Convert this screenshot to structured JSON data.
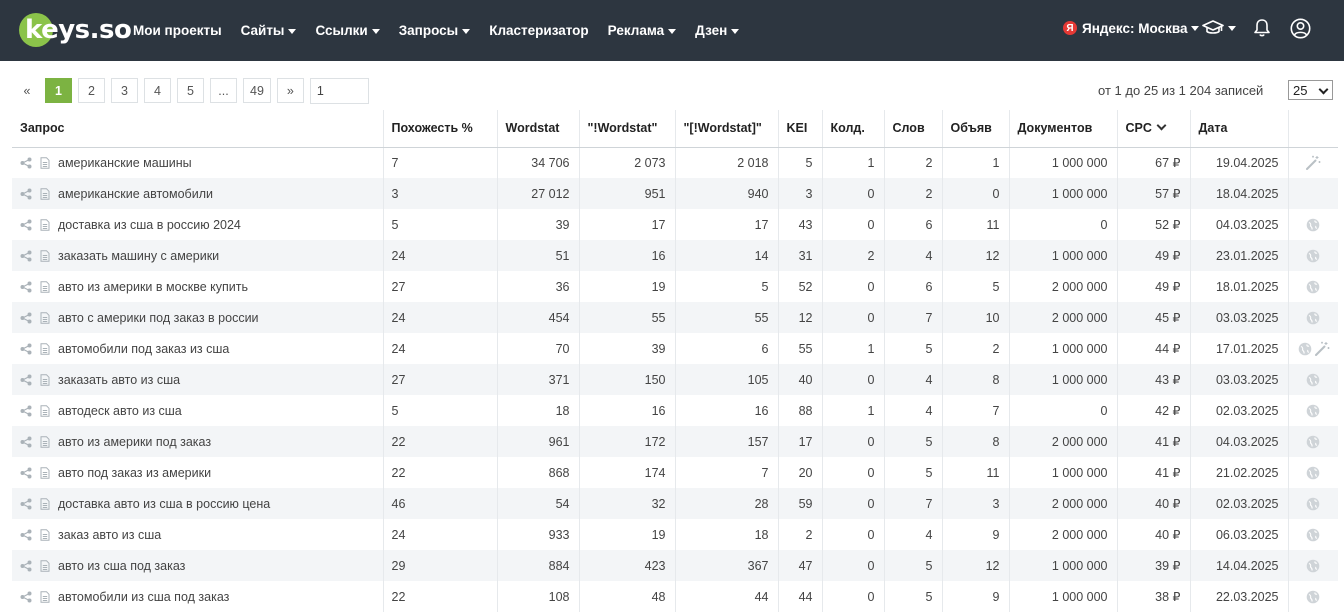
{
  "header": {
    "logo": "keys.so",
    "nav": [
      {
        "label": "Мои проекты",
        "dropdown": false
      },
      {
        "label": "Сайты",
        "dropdown": true
      },
      {
        "label": "Ссылки",
        "dropdown": true
      },
      {
        "label": "Запросы",
        "dropdown": true
      },
      {
        "label": "Кластеризатор",
        "dropdown": false
      },
      {
        "label": "Реклама",
        "dropdown": true
      },
      {
        "label": "Дзен",
        "dropdown": true
      }
    ],
    "region_badge": "Я",
    "region": "Яндекс: Москва",
    "icons": [
      "graduation-cap-icon",
      "bell-icon",
      "user-icon"
    ]
  },
  "pagination": {
    "prev": "«",
    "pages": [
      "1",
      "2",
      "3",
      "4",
      "5",
      "...",
      "49"
    ],
    "current": "1",
    "next": "»",
    "goto_value": "1",
    "records_text": "от 1 до 25 из 1 204 записей",
    "per_page": "25"
  },
  "table": {
    "columns": [
      "Запрос",
      "Похожесть %",
      "Wordstat",
      "\"!Wordstat\"",
      "\"[!Wordstat]\"",
      "KEI",
      "Колд.",
      "Слов",
      "Объяв",
      "Документов",
      "CPC",
      "Дата",
      ""
    ],
    "sorted_column": "CPC",
    "rows": [
      {
        "query": "американские машины",
        "similarity": "7",
        "wordstat": "34 706",
        "ws_excl": "2 073",
        "ws_exact": "2 018",
        "kei": "5",
        "kold": "1",
        "words": "2",
        "ads": "1",
        "docs": "1 000 000",
        "cpc": "67 ₽",
        "date": "19.04.2025",
        "actions": [
          "wand-icon"
        ]
      },
      {
        "query": "американские автомобили",
        "similarity": "3",
        "wordstat": "27 012",
        "ws_excl": "951",
        "ws_exact": "940",
        "kei": "3",
        "kold": "0",
        "words": "2",
        "ads": "0",
        "docs": "1 000 000",
        "cpc": "57 ₽",
        "date": "18.04.2025",
        "actions": []
      },
      {
        "query": "доставка из сша в россию 2024",
        "similarity": "5",
        "wordstat": "39",
        "ws_excl": "17",
        "ws_exact": "17",
        "kei": "43",
        "kold": "0",
        "words": "6",
        "ads": "11",
        "docs": "0",
        "cpc": "52 ₽",
        "date": "04.03.2025",
        "actions": [
          "globe-icon"
        ]
      },
      {
        "query": "заказать машину с америки",
        "similarity": "24",
        "wordstat": "51",
        "ws_excl": "16",
        "ws_exact": "14",
        "kei": "31",
        "kold": "2",
        "words": "4",
        "ads": "12",
        "docs": "1 000 000",
        "cpc": "49 ₽",
        "date": "23.01.2025",
        "actions": [
          "globe-icon"
        ]
      },
      {
        "query": "авто из америки в москве купить",
        "similarity": "27",
        "wordstat": "36",
        "ws_excl": "19",
        "ws_exact": "5",
        "kei": "52",
        "kold": "0",
        "words": "6",
        "ads": "5",
        "docs": "2 000 000",
        "cpc": "49 ₽",
        "date": "18.01.2025",
        "actions": [
          "globe-icon"
        ]
      },
      {
        "query": "авто с америки под заказ в россии",
        "similarity": "24",
        "wordstat": "454",
        "ws_excl": "55",
        "ws_exact": "55",
        "kei": "12",
        "kold": "0",
        "words": "7",
        "ads": "10",
        "docs": "2 000 000",
        "cpc": "45 ₽",
        "date": "03.03.2025",
        "actions": [
          "globe-icon"
        ]
      },
      {
        "query": "автомобили под заказ из сша",
        "similarity": "24",
        "wordstat": "70",
        "ws_excl": "39",
        "ws_exact": "6",
        "kei": "55",
        "kold": "1",
        "words": "5",
        "ads": "2",
        "docs": "1 000 000",
        "cpc": "44 ₽",
        "date": "17.01.2025",
        "actions": [
          "globe-icon",
          "wand-icon"
        ]
      },
      {
        "query": "заказать авто из сша",
        "similarity": "27",
        "wordstat": "371",
        "ws_excl": "150",
        "ws_exact": "105",
        "kei": "40",
        "kold": "0",
        "words": "4",
        "ads": "8",
        "docs": "1 000 000",
        "cpc": "43 ₽",
        "date": "03.03.2025",
        "actions": [
          "globe-icon"
        ]
      },
      {
        "query": "автодеск авто из сша",
        "similarity": "5",
        "wordstat": "18",
        "ws_excl": "16",
        "ws_exact": "16",
        "kei": "88",
        "kold": "1",
        "words": "4",
        "ads": "7",
        "docs": "0",
        "cpc": "42 ₽",
        "date": "02.03.2025",
        "actions": [
          "globe-icon"
        ]
      },
      {
        "query": "авто из америки под заказ",
        "similarity": "22",
        "wordstat": "961",
        "ws_excl": "172",
        "ws_exact": "157",
        "kei": "17",
        "kold": "0",
        "words": "5",
        "ads": "8",
        "docs": "2 000 000",
        "cpc": "41 ₽",
        "date": "04.03.2025",
        "actions": [
          "globe-icon"
        ]
      },
      {
        "query": "авто под заказ из америки",
        "similarity": "22",
        "wordstat": "868",
        "ws_excl": "174",
        "ws_exact": "7",
        "kei": "20",
        "kold": "0",
        "words": "5",
        "ads": "11",
        "docs": "1 000 000",
        "cpc": "41 ₽",
        "date": "21.02.2025",
        "actions": [
          "globe-icon"
        ]
      },
      {
        "query": "доставка авто из сша в россию цена",
        "similarity": "46",
        "wordstat": "54",
        "ws_excl": "32",
        "ws_exact": "28",
        "kei": "59",
        "kold": "0",
        "words": "7",
        "ads": "3",
        "docs": "2 000 000",
        "cpc": "40 ₽",
        "date": "02.03.2025",
        "actions": [
          "globe-icon"
        ]
      },
      {
        "query": "заказ авто из сша",
        "similarity": "24",
        "wordstat": "933",
        "ws_excl": "19",
        "ws_exact": "18",
        "kei": "2",
        "kold": "0",
        "words": "4",
        "ads": "9",
        "docs": "2 000 000",
        "cpc": "40 ₽",
        "date": "06.03.2025",
        "actions": [
          "globe-icon"
        ]
      },
      {
        "query": "авто из сша под заказ",
        "similarity": "29",
        "wordstat": "884",
        "ws_excl": "423",
        "ws_exact": "367",
        "kei": "47",
        "kold": "0",
        "words": "5",
        "ads": "12",
        "docs": "1 000 000",
        "cpc": "39 ₽",
        "date": "14.04.2025",
        "actions": [
          "globe-icon"
        ]
      },
      {
        "query": "автомобили из сша под заказ",
        "similarity": "22",
        "wordstat": "108",
        "ws_excl": "48",
        "ws_exact": "44",
        "kei": "44",
        "kold": "0",
        "words": "5",
        "ads": "9",
        "docs": "1 000 000",
        "cpc": "38 ₽",
        "date": "22.03.2025",
        "actions": [
          "globe-icon"
        ]
      }
    ]
  },
  "colors": {
    "header_bg": "#2d3640",
    "accent_green": "#7cb342",
    "row_alt": "#f3f5f7",
    "region_badge": "#e53935"
  }
}
